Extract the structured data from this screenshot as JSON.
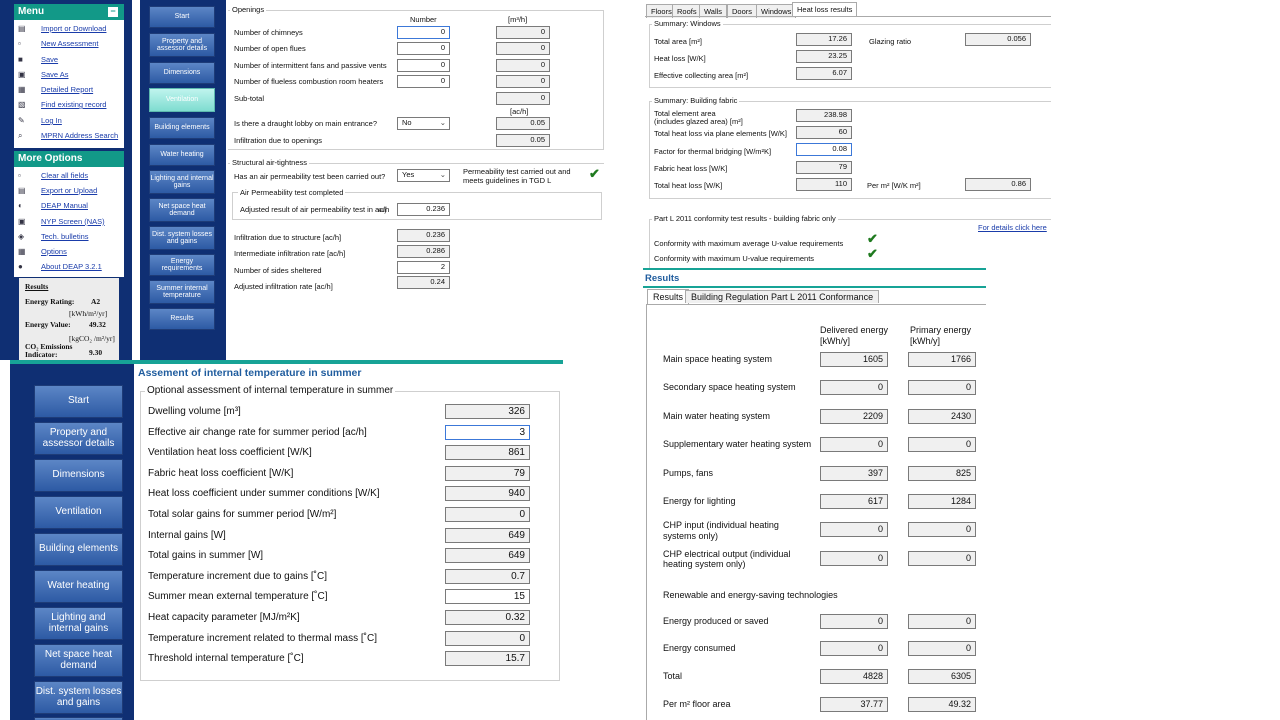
{
  "menu": {
    "menu_title": "Menu",
    "items": [
      {
        "label": "Import or Download",
        "icon": "import-icon"
      },
      {
        "label": "New Assessment",
        "icon": "new-document-icon"
      },
      {
        "label": "Save",
        "icon": "save-icon"
      },
      {
        "label": "Save As",
        "icon": "save-as-icon"
      },
      {
        "label": "Detailed Report",
        "icon": "report-icon"
      },
      {
        "label": "Find existing record",
        "icon": "find-icon"
      },
      {
        "label": "Log In",
        "icon": "key-icon"
      },
      {
        "label": "MPRN Address Search",
        "icon": "search-icon"
      }
    ],
    "more_title": "More Options",
    "more_items": [
      {
        "label": "Clear all fields",
        "icon": "clear-icon"
      },
      {
        "label": "Export or Upload",
        "icon": "export-icon"
      },
      {
        "label": "DEAP Manual",
        "icon": "manual-icon"
      },
      {
        "label": "NYP Screen (NAS)",
        "icon": "screen-icon"
      },
      {
        "label": "Tech. bulletins",
        "icon": "bulletin-icon"
      },
      {
        "label": "Options",
        "icon": "options-icon"
      },
      {
        "label": "About DEAP 3.2.1",
        "icon": "info-icon"
      }
    ],
    "results": {
      "title": "Results",
      "rating_label": "Energy Rating:",
      "rating_value": "A2",
      "energy_unit": "[kWh/m²/yr]",
      "energy_label": "Energy Value:",
      "energy_value": "49.32",
      "co2_unit": "[kgCO₂ /m²/yr]",
      "co2_label": "CO₂ Emissions Indicator:",
      "co2_value": "9.30"
    }
  },
  "nav": [
    "Start",
    "Property and assessor details",
    "Dimensions",
    "Ventilation",
    "Building elements",
    "Water heating",
    "Lighting and internal gains",
    "Net space heat demand",
    "Dist. system losses and gains",
    "Energy requirements",
    "Summer internal temperature",
    "Results"
  ],
  "nav_active_small": "Ventilation",
  "ventilation": {
    "openings_title": "Openings",
    "col_number": "Number",
    "col_unit": "[m³/h]",
    "rows": [
      {
        "label": "Number of chimneys",
        "number": "0",
        "flow": "0"
      },
      {
        "label": "Number of open flues",
        "number": "0",
        "flow": "0"
      },
      {
        "label": "Number of intermittent fans and passive vents",
        "number": "0",
        "flow": "0"
      },
      {
        "label": "Number of flueless combustion room heaters",
        "number": "0",
        "flow": "0"
      }
    ],
    "subtotal_label": "Sub-total",
    "subtotal_value": "0",
    "ach_unit": "[ac/h]",
    "lobby_label": "Is there a draught lobby on main entrance?",
    "lobby_value": "No",
    "lobby_ach": "0.05",
    "infil_openings_label": "Infiltration due to openings",
    "infil_openings_value": "0.05",
    "airtight_title": "Structural air-tightness",
    "perm_test_label": "Has an air permeability test been carried out?",
    "perm_test_value": "Yes",
    "perm_note": "Permeability test carried out and meets guidelines in TGD L",
    "perm_group_title": "Air Permeability test completed",
    "adjusted_label": "Adjusted result of air permeability test in ac/h",
    "adjusted_sub": "adj",
    "adjusted_value": "0.236",
    "structure_label": "Infiltration due to structure [ac/h]",
    "structure_value": "0.236",
    "intermediate_label": "Intermediate infiltration rate [ac/h]",
    "intermediate_value": "0.286",
    "sheltered_label": "Number of sides sheltered",
    "sheltered_value": "2",
    "adjusted_infil_label": "Adjusted infiltration rate  [ac/h]",
    "adjusted_infil_value": "0.24"
  },
  "heatloss": {
    "tabs": [
      "Floors",
      "Roofs",
      "Walls",
      "Doors",
      "Windows",
      "Heat loss results"
    ],
    "windows_title": "Summary: Windows",
    "total_area_label": "Total area [m²]",
    "total_area_value": "17.26",
    "glazing_label": "Glazing ratio",
    "glazing_value": "0.056",
    "win_heatloss_label": "Heat loss [W/K]",
    "win_heatloss_value": "23.25",
    "collecting_label": "Effective collecting area [m²]",
    "collecting_value": "6.07",
    "fabric_title": "Summary: Building fabric",
    "element_area_label": "Total element area",
    "element_area_label2": "(includes glazed area) [m²]",
    "element_area_value": "238.98",
    "plane_label": "Total heat loss via plane elements [W/K]",
    "plane_value": "60",
    "bridging_label": "Factor for thermal bridging [W/m²K]",
    "bridging_value": "0.08",
    "fabric_loss_label": "Fabric heat loss [W/K]",
    "fabric_loss_value": "79",
    "total_loss_label": "Total heat loss [W/K]",
    "total_loss_value": "110",
    "per_m2_label": "Per m² [W/K m²]",
    "per_m2_value": "0.86",
    "partl_title": "Part L 2011 conformity test results - building fabric only",
    "details_link": "For details click here",
    "conf1_label": "Conformity with maximum average U-value requirements",
    "conf2_label": "Conformity with maximum U-value requirements"
  },
  "summer": {
    "title": "Assement of internal temperature in summer",
    "group_title": "Optional assessment of internal temperature in summer",
    "rows": [
      {
        "label": "Dwelling volume [m³]",
        "value": "326"
      },
      {
        "label": "Effective air change rate for summer period [ac/h]",
        "value": "3"
      },
      {
        "label": "Ventilation heat loss coefficient [W/K]",
        "value": "861"
      },
      {
        "label": "Fabric heat loss coefficient [W/K]",
        "value": "79"
      },
      {
        "label": "Heat loss coefficient under summer conditions [W/K]",
        "value": "940"
      },
      {
        "label": "Total solar gains for summer period [W/m²]",
        "value": "0"
      },
      {
        "label": "Internal gains [W]",
        "value": "649"
      },
      {
        "label": "Total gains in summer [W]",
        "value": "649"
      },
      {
        "label": "Temperature increment due to gains  [˚C]",
        "value": "0.7"
      },
      {
        "label": "Summer mean external temperature [˚C]",
        "value": "15"
      },
      {
        "label": "Heat capacity parameter [MJ/m²K]",
        "value": "0.32"
      },
      {
        "label": "Temperature increment related to thermal mass  [˚C]",
        "value": "0"
      },
      {
        "label": "Threshold internal temperature [˚C]",
        "value": "15.7"
      }
    ]
  },
  "results": {
    "title": "Results",
    "tabs": [
      "Results",
      "Building Regulation Part L 2011 Conformance"
    ],
    "col_delivered": "Delivered energy",
    "col_primary": "Primary energy",
    "col_unit": "[kWh/y]",
    "rows": [
      {
        "label": "Main space heating system",
        "delivered": "1605",
        "primary": "1766"
      },
      {
        "label": "Secondary space heating system",
        "delivered": "0",
        "primary": "0"
      },
      {
        "label": "Main water heating system",
        "delivered": "2209",
        "primary": "2430"
      },
      {
        "label": "Supplementary water heating system",
        "delivered": "0",
        "primary": "0"
      },
      {
        "label": "Pumps, fans",
        "delivered": "397",
        "primary": "825"
      },
      {
        "label": "Energy for lighting",
        "delivered": "617",
        "primary": "1284"
      },
      {
        "label": "CHP input (individual heating systems only)",
        "delivered": "0",
        "primary": "0"
      },
      {
        "label": "CHP electrical output (individual heating system only)",
        "delivered": "0",
        "primary": "0"
      }
    ],
    "renewable_title": "Renewable and energy-saving technologies",
    "rows2": [
      {
        "label": "Energy produced or saved",
        "delivered": "0",
        "primary": "0"
      },
      {
        "label": "Energy consumed",
        "delivered": "0",
        "primary": "0"
      },
      {
        "label": "Total",
        "delivered": "4828",
        "primary": "6305"
      },
      {
        "label": "Per m² floor area",
        "delivered": "37.77",
        "primary": "49.32"
      }
    ]
  }
}
